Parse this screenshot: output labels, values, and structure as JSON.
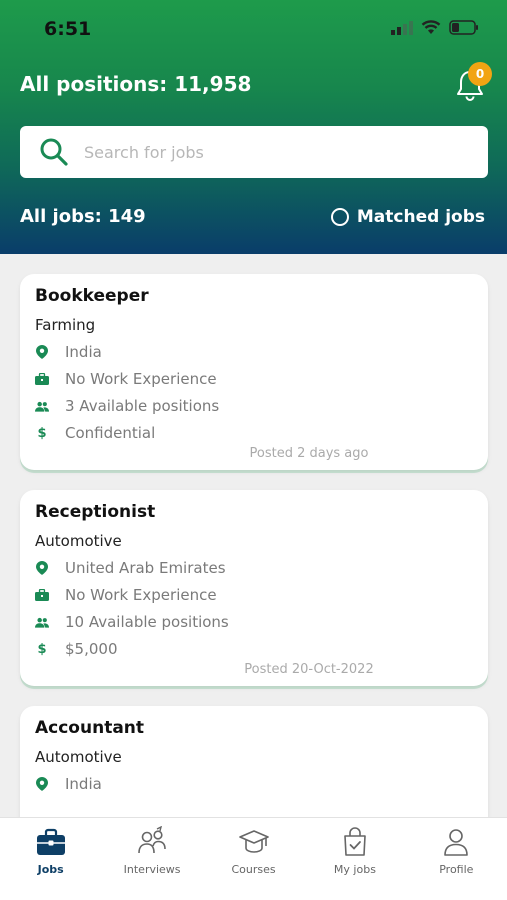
{
  "status": {
    "time": "6:51"
  },
  "header": {
    "positions_label": "All positions: 11,958",
    "notification_count": "0"
  },
  "search": {
    "placeholder": "Search for jobs"
  },
  "filters": {
    "all_jobs_label": "All jobs: 149",
    "matched_label": "Matched jobs"
  },
  "jobs": [
    {
      "title": "Bookkeeper",
      "sector": "Farming",
      "location": "India",
      "experience": "No Work Experience",
      "positions": "3 Available positions",
      "salary": "Confidential",
      "posted": "Posted 2 days ago"
    },
    {
      "title": "Receptionist",
      "sector": "Automotive",
      "location": "United Arab Emirates",
      "experience": "No Work Experience",
      "positions": "10 Available positions",
      "salary": "$5,000",
      "posted": "Posted 20-Oct-2022"
    },
    {
      "title": "Accountant",
      "sector": "Automotive",
      "location": "India"
    }
  ],
  "tabs": [
    {
      "label": "Jobs",
      "icon": "briefcase-icon"
    },
    {
      "label": "Interviews",
      "icon": "interviews-icon"
    },
    {
      "label": "Courses",
      "icon": "graduation-cap-icon"
    },
    {
      "label": "My jobs",
      "icon": "shopping-bag-check-icon"
    },
    {
      "label": "Profile",
      "icon": "person-icon"
    }
  ],
  "colors": {
    "accent_green": "#1a8a55",
    "header_top": "#1e9b4b",
    "header_bottom": "#0a3d6a",
    "badge": "#f2a413",
    "active_tab": "#0e3f66"
  }
}
